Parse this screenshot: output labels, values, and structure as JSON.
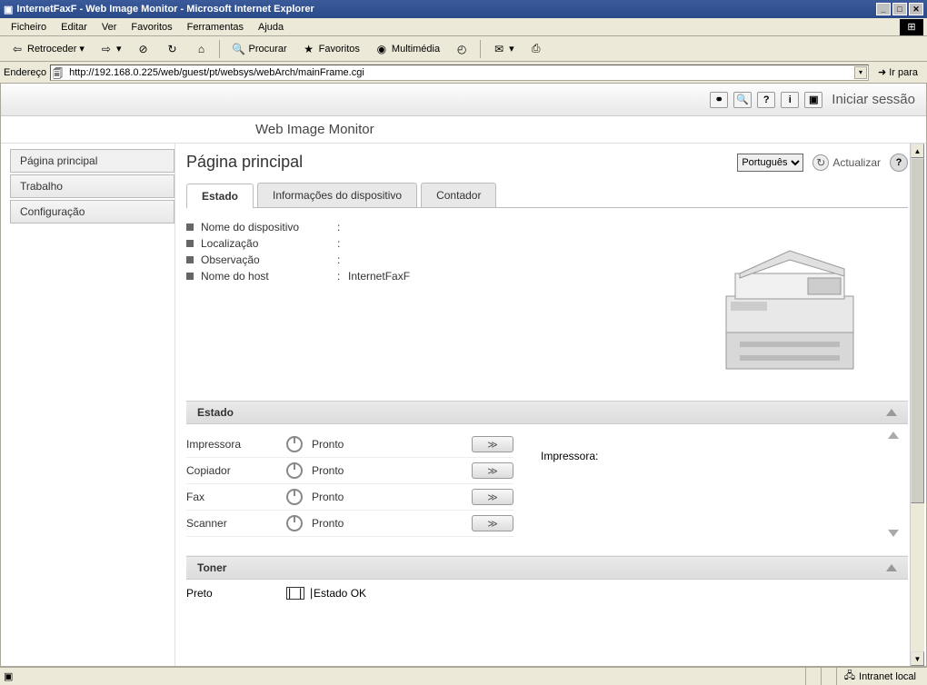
{
  "window": {
    "title": "InternetFaxF - Web Image Monitor - Microsoft Internet Explorer"
  },
  "menu": {
    "file": "Ficheiro",
    "edit": "Editar",
    "view": "Ver",
    "favorites": "Favoritos",
    "tools": "Ferramentas",
    "help": "Ajuda"
  },
  "toolbar": {
    "back": "Retroceder",
    "search": "Procurar",
    "favorites": "Favoritos",
    "media": "Multimédia"
  },
  "address": {
    "label": "Endereço",
    "url": "http://192.168.0.225/web/guest/pt/websys/webArch/mainFrame.cgi",
    "go": "Ir para"
  },
  "topnav": {
    "login": "Iniciar sessão"
  },
  "app": {
    "title": "Web Image Monitor"
  },
  "sidebar": {
    "items": [
      {
        "label": "Página principal"
      },
      {
        "label": "Trabalho"
      },
      {
        "label": "Configuração"
      }
    ]
  },
  "page": {
    "heading": "Página principal",
    "language": "Português",
    "refresh": "Actualizar"
  },
  "tabs": [
    {
      "label": "Estado"
    },
    {
      "label": "Informações do dispositivo"
    },
    {
      "label": "Contador"
    }
  ],
  "device": {
    "rows": [
      {
        "label": "Nome do dispositivo",
        "value": ""
      },
      {
        "label": "Localização",
        "value": ""
      },
      {
        "label": "Observação",
        "value": ""
      },
      {
        "label": "Nome do host",
        "value": "InternetFaxF"
      }
    ]
  },
  "sections": {
    "status": "Estado",
    "toner": "Toner"
  },
  "status": {
    "rows": [
      {
        "name": "Impressora",
        "state": "Pronto"
      },
      {
        "name": "Copiador",
        "state": "Pronto"
      },
      {
        "name": "Fax",
        "state": "Pronto"
      },
      {
        "name": "Scanner",
        "state": "Pronto"
      }
    ],
    "detail_label": "Impressora:"
  },
  "toner": {
    "name": "Preto",
    "state": "Estado OK"
  },
  "statusbar": {
    "zone": "Intranet local"
  }
}
